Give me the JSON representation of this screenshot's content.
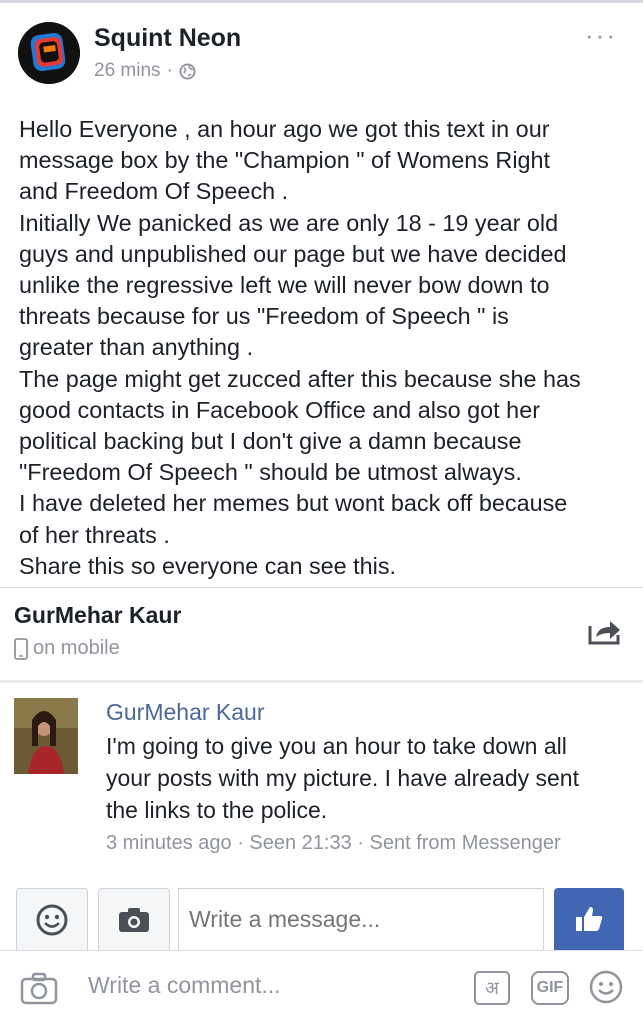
{
  "post": {
    "author": "Squint Neon",
    "time": "26 mins",
    "dot": "·",
    "more": "···",
    "lines": [
      "Hello Everyone , an hour ago we got this text in our",
      "message box by the \"Champion \" of Womens Right",
      "and Freedom Of Speech .",
      "Initially We panicked as we are only 18 - 19 year old",
      "guys  and unpublished our page but we have decided",
      "unlike the regressive left we will never bow down to",
      "threats because for us \"Freedom of  Speech \" is",
      "greater than anything .",
      "The page might get zucced after this because she has",
      "good contacts in Facebook Office and also got her",
      "political backing but I don't give a damn because",
      "\"Freedom Of Speech \" should be utmost always.",
      "I have deleted her memes but wont back off because",
      "of her threats .",
      "Share this so everyone can see this."
    ]
  },
  "conversation": {
    "name": "GurMehar Kaur",
    "status": "on mobile"
  },
  "message": {
    "sender": "GurMehar Kaur",
    "lines": [
      "I'm going to give you an hour to take down all",
      "your posts with my picture. I have already sent",
      "the links to the police."
    ],
    "meta": "3 minutes ago · Seen 21:33 · Sent from Messenger"
  },
  "composer": {
    "placeholder": "Write a message..."
  },
  "comment_bar": {
    "placeholder": "Write a comment...",
    "hindi_label": "अ",
    "gif_label": "GIF"
  },
  "colors": {
    "link_blue": "#4b6799",
    "like_button": "#4267b2",
    "meta_gray": "#90949c"
  },
  "icons": [
    "globe-icon",
    "phone-icon",
    "share-icon",
    "emoji-icon",
    "camera-icon",
    "thumbs-up-icon",
    "comment-camera-icon",
    "hindi-keyboard-icon",
    "gif-icon",
    "comment-emoji-icon"
  ]
}
